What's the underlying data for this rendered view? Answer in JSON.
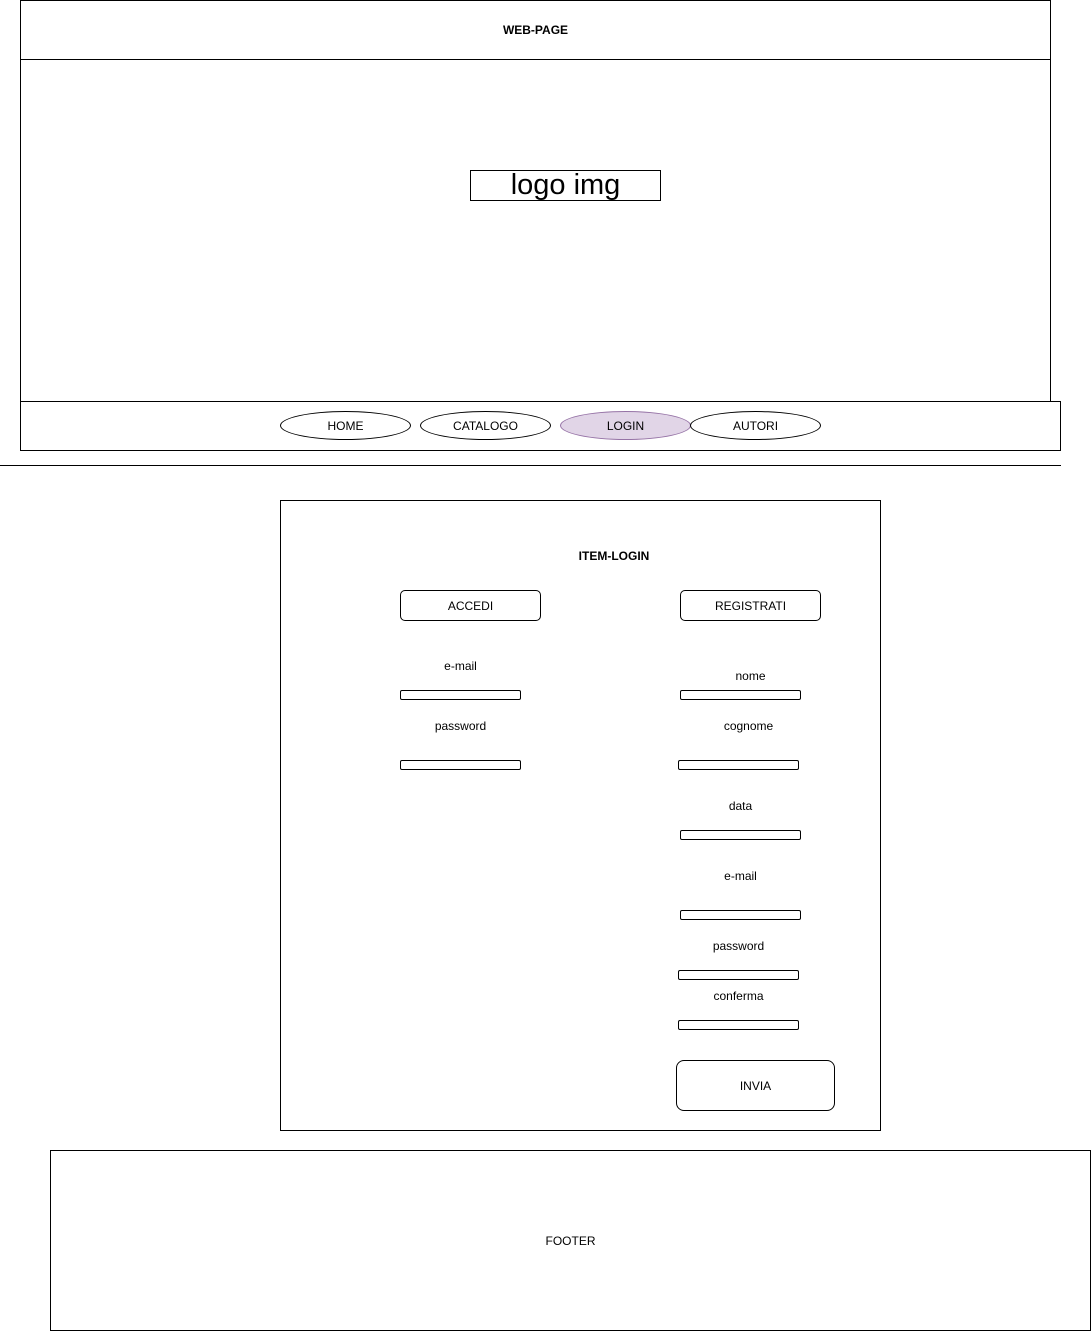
{
  "header": {
    "title": "WEB-PAGE",
    "logo": "logo img"
  },
  "nav": {
    "items": [
      {
        "label": "HOME"
      },
      {
        "label": "CATALOGO"
      },
      {
        "label": "LOGIN",
        "active": true
      },
      {
        "label": "AUTORI"
      }
    ],
    "active_fill": "#e1d5e7",
    "active_stroke": "#9673a6"
  },
  "login": {
    "title": "ITEM-LOGIN",
    "accedi": {
      "button": "ACCEDI",
      "email_label": "e-mail",
      "password_label": "password"
    },
    "registrati": {
      "button": "REGISTRATI",
      "nome_label": "nome",
      "cognome_label": "cognome",
      "data_label": "data",
      "email_label": "e-mail",
      "password_label": "password",
      "conferma_label": "conferma",
      "submit": "INVIA"
    }
  },
  "footer": {
    "label": "FOOTER"
  }
}
